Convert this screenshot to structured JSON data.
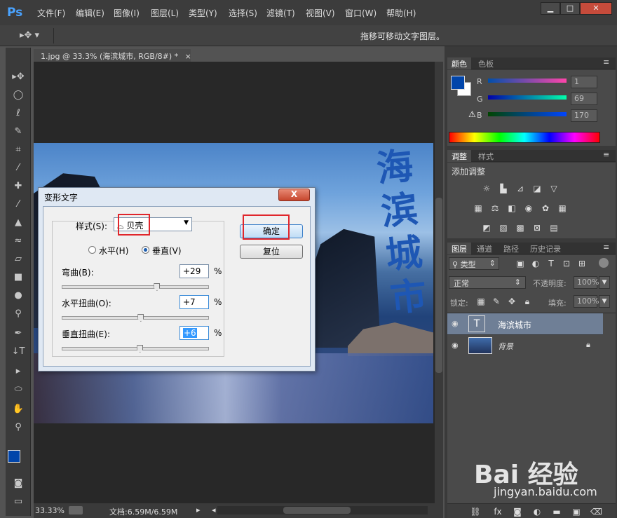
{
  "app": {
    "logo": "Ps"
  },
  "menu": [
    "文件(F)",
    "编辑(E)",
    "图像(I)",
    "图层(L)",
    "类型(Y)",
    "选择(S)",
    "滤镜(T)",
    "视图(V)",
    "窗口(W)",
    "帮助(H)"
  ],
  "window_buttons": {
    "minimize": "▁",
    "restore": "□",
    "close": "✕"
  },
  "options_bar": {
    "hint": "拖移可移动文字图层。"
  },
  "document": {
    "tab_title": "1.jpg @ 33.3% (海滨城市, RGB/8#) *",
    "tab_close": "×",
    "vertical_text": "海滨城市"
  },
  "status": {
    "zoom": "33.33%",
    "doc_info": "文档:6.59M/6.59M"
  },
  "color_panel": {
    "tabs": [
      "颜色",
      "色板"
    ],
    "r_label": "R",
    "g_label": "G",
    "b_label": "B",
    "r_value": "1",
    "g_value": "69",
    "b_value": "170",
    "foreground_color": "#0145AA"
  },
  "adjustments_panel": {
    "tabs": [
      "调整",
      "样式"
    ],
    "title": "添加调整"
  },
  "layers_panel": {
    "tabs": [
      "图层",
      "通道",
      "路径",
      "历史记录"
    ],
    "filter_label": "类型",
    "blend_mode": "正常",
    "opacity_label": "不透明度:",
    "opacity_value": "100%",
    "lock_label": "锁定:",
    "fill_label": "填充:",
    "fill_value": "100%",
    "layers": [
      {
        "name": "海滨城市",
        "type": "text",
        "thumb": "T"
      },
      {
        "name": "背景",
        "type": "image"
      }
    ],
    "bottom_icons": [
      "link-icon",
      "fx-icon",
      "mask-icon",
      "adjustment-icon",
      "folder-icon",
      "new-layer-icon",
      "trash-icon"
    ]
  },
  "dialog": {
    "title": "变形文字",
    "close": "X",
    "style_label": "样式(S):",
    "style_value": "贝壳",
    "horizontal_label": "水平(H)",
    "vertical_label": "垂直(V)",
    "bend_label": "弯曲(B):",
    "bend_value": "+29",
    "hdistort_label": "水平扭曲(O):",
    "hdistort_value": "+7",
    "vdistort_label": "垂直扭曲(E):",
    "vdistort_value": "+6",
    "percent": "%",
    "ok_label": "确定",
    "reset_label": "复位",
    "bend_level": 0.645,
    "hdistort_level": 0.535,
    "vdistort_level": 0.53
  },
  "watermark": {
    "text": "Bai 经验",
    "url": "jingyan.baidu.com"
  }
}
